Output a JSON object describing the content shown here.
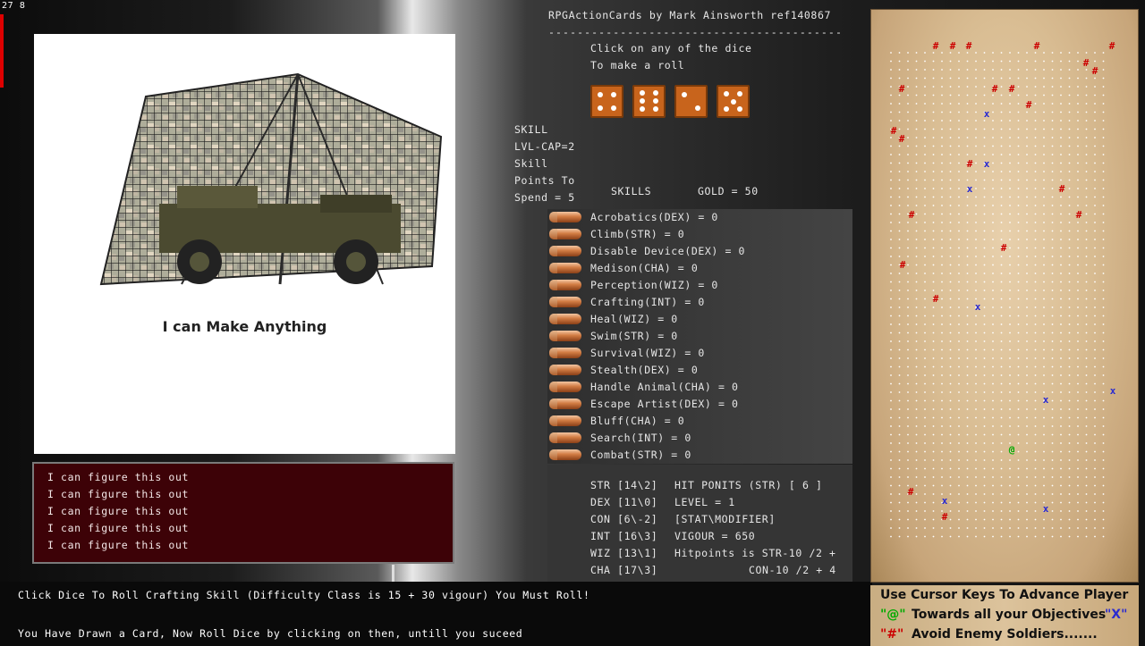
{
  "corner_text": "27 8",
  "header": {
    "title": "RPGActionCards by Mark Ainsworth ref140867",
    "rule": "-----------------------------------------",
    "prompt_line1": "Click on any of the dice",
    "prompt_line2": "To make a roll"
  },
  "dice": [
    {
      "name": "die-1",
      "face": 4
    },
    {
      "name": "die-2",
      "face": 6
    },
    {
      "name": "die-3",
      "face": 2
    },
    {
      "name": "die-4",
      "face": 5
    }
  ],
  "card": {
    "image": "camouflaged-jeep-under-net",
    "caption": "I can Make Anything"
  },
  "log": {
    "lines": [
      "I can figure this out",
      "I can figure this out",
      "I can figure this out",
      "I can figure this out",
      "I can figure this out"
    ]
  },
  "skill_info": {
    "line1": "SKILL",
    "line2": "LVL-CAP=2",
    "line3": "Skill",
    "line4": "Points To",
    "line5": "Spend = 5",
    "skills_title": "SKILLS",
    "gold": "GOLD = 50"
  },
  "skills": [
    "Acrobatics(DEX) = 0",
    "Climb(STR) = 0",
    "Disable Device(DEX) = 0",
    "Medison(CHA) = 0",
    "Perception(WIZ) = 0",
    "Crafting(INT) = 0",
    "Heal(WIZ) = 0",
    "Swim(STR) = 0",
    "Survival(WIZ) = 0",
    "Stealth(DEX) = 0",
    "Handle Animal(CHA) = 0",
    "Escape Artist(DEX) = 0",
    "Bluff(CHA) = 0",
    "Search(INT) = 0",
    "Combat(STR) = 0"
  ],
  "stats": {
    "str": "STR [14\\2]",
    "dex": "DEX [11\\0]",
    "con": "CON [6\\-2]",
    "int": "INT [16\\3]",
    "wiz": "WIZ [13\\1]",
    "cha": "CHA [17\\3]",
    "hit_points": "HIT PONITS (STR) [ 6 ]",
    "level": "LEVEL = 1",
    "modifier": "[STAT\\MODIFIER]",
    "vigour": "VIGOUR = 650",
    "hp_formula1": "Hitpoints is STR-10 /2 +",
    "hp_formula2": "CON-10 /2 + 4"
  },
  "status": {
    "line1": "Click Dice To Roll Crafting Skill (Difficulty Class is 15 + 30 vigour) You Must Roll!",
    "line2": "You Have Drawn a Card, Now Roll Dice by clicking on then, untill you suceed"
  },
  "map": {
    "background": "parchment",
    "player_symbol": "@",
    "objective_symbol": "X",
    "enemy_symbol": "#"
  },
  "legend": {
    "line1": "Use Cursor Keys To Advance Player",
    "player": "\"@\"",
    "line2": "Towards all your Objectives",
    "objective": "\"X\"",
    "enemy": "\"#\"",
    "line3": "Avoid Enemy Soldiers......."
  },
  "colors": {
    "player": "#00aa00",
    "objective": "#2b2bd0",
    "enemy": "#cc0000",
    "log_bg": "#3d0207",
    "die": "#c8641c"
  }
}
